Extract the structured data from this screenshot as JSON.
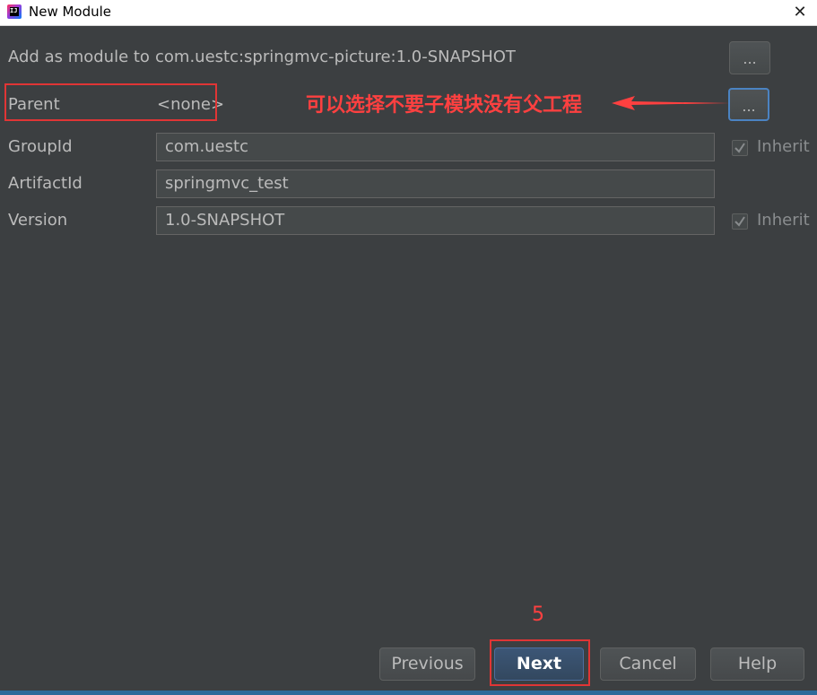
{
  "window": {
    "title": "New Module",
    "app_icon_text": "IJ",
    "close_glyph": "✕"
  },
  "form": {
    "add_as_module_label": "Add as module to",
    "add_as_module_value": "com.uestc:springmvc-picture:1.0-SNAPSHOT",
    "parent_label": "Parent",
    "parent_value": "<none>",
    "group_id_label": "GroupId",
    "group_id_value": "com.uestc",
    "artifact_id_label": "ArtifactId",
    "artifact_id_value": "springmvc_test",
    "version_label": "Version",
    "version_value": "1.0-SNAPSHOT",
    "inherit_label": "Inherit",
    "browse_label": "...",
    "group_id_inherit_checked": true,
    "version_inherit_checked": true
  },
  "annotations": {
    "parent_note": "可以选择不要子模块没有父工程",
    "step_number": "5",
    "color": "#ff4040"
  },
  "buttons": {
    "previous": "Previous",
    "next": "Next",
    "cancel": "Cancel",
    "help": "Help"
  },
  "colors": {
    "background": "#3c3f41",
    "field_background": "#45494a",
    "text": "#bbbbbb",
    "default_button": "#365880",
    "focus_border": "#4b83c2"
  }
}
